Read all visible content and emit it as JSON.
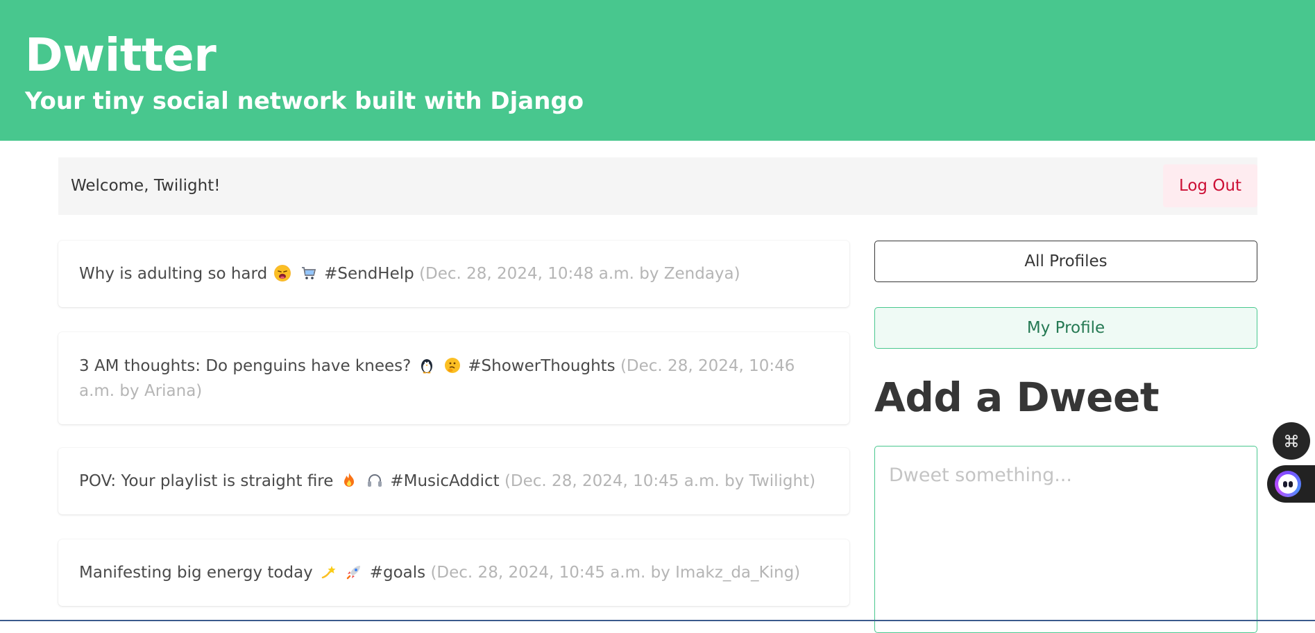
{
  "hero": {
    "title": "Dwitter",
    "subtitle": "Your tiny social network built with Django"
  },
  "navbar": {
    "welcome": "Welcome, Twilight!",
    "logout_label": "Log Out"
  },
  "feed": [
    {
      "text": "Why is adulting so hard",
      "emojis": [
        "weary-face-emoji",
        "shopping-cart-emoji"
      ],
      "hashtag": "#SendHelp",
      "meta": "(Dec. 28, 2024, 10:48 a.m. by Zendaya)"
    },
    {
      "text": "3 AM thoughts: Do penguins have knees?",
      "emojis": [
        "penguin-emoji",
        "thinking-face-emoji"
      ],
      "hashtag": "#ShowerThoughts",
      "meta": "(Dec. 28, 2024, 10:46 a.m. by Ariana)"
    },
    {
      "text": "POV: Your playlist is straight fire",
      "emojis": [
        "fire-emoji",
        "headphones-emoji"
      ],
      "hashtag": "#MusicAddict",
      "meta": "(Dec. 28, 2024, 10:45 a.m. by Twilight)"
    },
    {
      "text": "Manifesting big energy today",
      "emojis": [
        "dizzy-emoji",
        "rocket-emoji"
      ],
      "hashtag": "#goals",
      "meta": "(Dec. 28, 2024, 10:45 a.m. by Imakz_da_King)"
    }
  ],
  "sidebar": {
    "all_profiles_label": "All Profiles",
    "my_profile_label": "My Profile",
    "add_title": "Add a Dweet",
    "textarea_placeholder": "Dweet something..."
  },
  "floating": {
    "command_icon": "command-icon",
    "assistant_icon": "assistant-bot-icon"
  },
  "colors": {
    "primary": "#48c78e",
    "danger_text": "#cc0f35",
    "danger_bg": "#feecf0",
    "meta_text": "#b5b5b5"
  }
}
